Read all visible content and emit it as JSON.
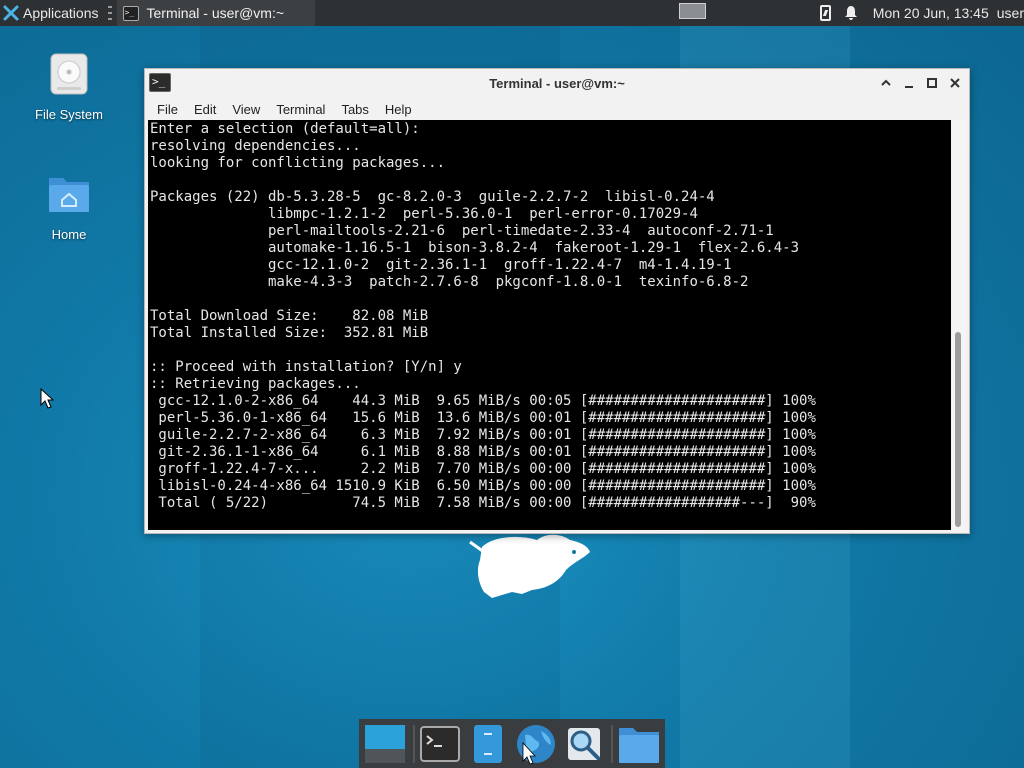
{
  "top_panel": {
    "applications_label": "Applications",
    "task_title": "Terminal - user@vm:~",
    "clock": "Mon 20 Jun, 13:45",
    "user": "user"
  },
  "desktop": {
    "icons": [
      {
        "label": "File System",
        "icon": "drive-icon"
      },
      {
        "label": "Home",
        "icon": "home-folder-icon"
      }
    ]
  },
  "window": {
    "title": "Terminal - user@vm:~",
    "menu": [
      "File",
      "Edit",
      "View",
      "Terminal",
      "Tabs",
      "Help"
    ],
    "controls": [
      "shade",
      "minimize",
      "maximize",
      "close"
    ]
  },
  "terminal": {
    "lines": [
      "Enter a selection (default=all):",
      "resolving dependencies...",
      "looking for conflicting packages...",
      "",
      "Packages (22) db-5.3.28-5  gc-8.2.0-3  guile-2.2.7-2  libisl-0.24-4",
      "              libmpc-1.2.1-2  perl-5.36.0-1  perl-error-0.17029-4",
      "              perl-mailtools-2.21-6  perl-timedate-2.33-4  autoconf-2.71-1",
      "              automake-1.16.5-1  bison-3.8.2-4  fakeroot-1.29-1  flex-2.6.4-3",
      "              gcc-12.1.0-2  git-2.36.1-1  groff-1.22.4-7  m4-1.4.19-1",
      "              make-4.3-3  patch-2.7.6-8  pkgconf-1.8.0-1  texinfo-6.8-2",
      "",
      "Total Download Size:    82.08 MiB",
      "Total Installed Size:  352.81 MiB",
      "",
      ":: Proceed with installation? [Y/n] y",
      ":: Retrieving packages...",
      " gcc-12.1.0-2-x86_64    44.3 MiB  9.65 MiB/s 00:05 [#####################] 100%",
      " perl-5.36.0-1-x86_64   15.6 MiB  13.6 MiB/s 00:01 [#####################] 100%",
      " guile-2.2.7-2-x86_64    6.3 MiB  7.92 MiB/s 00:01 [#####################] 100%",
      " git-2.36.1-1-x86_64     6.1 MiB  8.88 MiB/s 00:01 [#####################] 100%",
      " groff-1.22.4-7-x...     2.2 MiB  7.70 MiB/s 00:00 [#####################] 100%",
      " libisl-0.24-4-x86_64 1510.9 KiB  6.50 MiB/s 00:00 [#####################] 100%",
      " Total ( 5/22)          74.5 MiB  7.58 MiB/s 00:00 [##################---]  90%"
    ]
  },
  "dock": {
    "items": [
      "show-desktop-icon",
      "terminal-icon",
      "file-manager-icon",
      "web-browser-icon",
      "app-finder-icon",
      "folder-icon"
    ]
  },
  "colors": {
    "desktop_bg": "#1277a3",
    "panel_bg": "#2e3134",
    "terminal_bg": "#000000",
    "terminal_fg": "#e6e6e6",
    "dock_bg": "#3a3d40"
  }
}
